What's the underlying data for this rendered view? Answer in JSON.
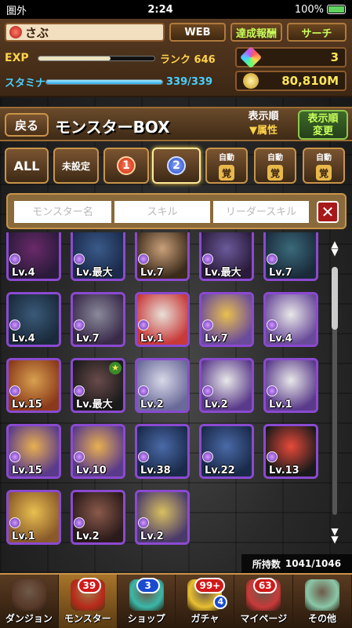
{
  "status_bar": {
    "carrier": "圏外",
    "time": "2:24",
    "battery": "100%"
  },
  "header": {
    "player_name": "さぶ",
    "web_label": "WEB",
    "achievements_label": "達成報酬",
    "search_label": "サーチ",
    "exp_label": "EXP",
    "exp_progress": 0.62,
    "rank_text": "ランク 646",
    "stamina_label": "スタミナ",
    "stamina_progress": 1.0,
    "stamina_text": "339/339",
    "gems": "3",
    "coins": "80,810M"
  },
  "title_bar": {
    "back_label": "戻る",
    "title": "モンスターBOX",
    "sort_label": "表示順",
    "sort_value": "▼属性",
    "sort_change_line1": "表示順",
    "sort_change_line2": "変更"
  },
  "filter_tabs": {
    "all": "ALL",
    "unset": "未設定",
    "box1": "1",
    "box2": "2",
    "auto_label": "自動",
    "auto_icons": [
      "覚",
      "覚",
      "覚"
    ]
  },
  "search": {
    "monster_placeholder": "モンスター名",
    "skill_placeholder": "スキル",
    "leader_placeholder": "リーダースキル"
  },
  "grid": {
    "rows": [
      [
        {
          "lv": "Lv.4",
          "c1": "#6a2a6a",
          "c2": "#2a1a3a",
          "plus": false
        },
        {
          "lv": "Lv.最大",
          "c1": "#3a5a8a",
          "c2": "#1a2a4a",
          "plus": false
        },
        {
          "lv": "Lv.7",
          "c1": "#caa07a",
          "c2": "#3a2a1a",
          "plus": false
        },
        {
          "lv": "Lv.最大",
          "c1": "#6a5a9a",
          "c2": "#2a1a3a",
          "plus": false
        },
        {
          "lv": "Lv.7",
          "c1": "#3a6a7a",
          "c2": "#1a2a3a",
          "plus": false
        }
      ],
      [
        {
          "lv": "Lv.4",
          "c1": "#3a5a7a",
          "c2": "#1a2a3a",
          "plus": false
        },
        {
          "lv": "Lv.7",
          "c1": "#8a8a9a",
          "c2": "#3a2a4a",
          "plus": false
        },
        {
          "lv": "Lv.1",
          "c1": "#e8e0d8",
          "c2": "#c83a3a",
          "plus": false
        },
        {
          "lv": "Lv.7",
          "c1": "#e8c050",
          "c2": "#6a4a9a",
          "plus": false
        },
        {
          "lv": "Lv.4",
          "c1": "#e8e8e8",
          "c2": "#6a4a9a",
          "plus": false
        }
      ],
      [
        {
          "lv": "Lv.15",
          "c1": "#d8a050",
          "c2": "#8a3a1a",
          "plus": false
        },
        {
          "lv": "Lv.最大",
          "c1": "#6a4a4a",
          "c2": "#1a1a1a",
          "plus": true
        },
        {
          "lv": "Lv.2",
          "c1": "#d8d8e8",
          "c2": "#6a6a9a",
          "plus": false
        },
        {
          "lv": "Lv.2",
          "c1": "#e8e8e8",
          "c2": "#5a3a8a",
          "plus": false
        },
        {
          "lv": "Lv.1",
          "c1": "#e8e8e8",
          "c2": "#5a3a8a",
          "plus": false
        }
      ],
      [
        {
          "lv": "Lv.15",
          "c1": "#e8b050",
          "c2": "#5a3a8a",
          "plus": false
        },
        {
          "lv": "Lv.10",
          "c1": "#e8b050",
          "c2": "#5a3a8a",
          "plus": false
        },
        {
          "lv": "Lv.38",
          "c1": "#4a6aa8",
          "c2": "#1a2a4a",
          "plus": false
        },
        {
          "lv": "Lv.22",
          "c1": "#4a6aa8",
          "c2": "#1a2a4a",
          "plus": false
        },
        {
          "lv": "Lv.13",
          "c1": "#e84a3a",
          "c2": "#1a1a1a",
          "plus": false
        }
      ],
      [
        {
          "lv": "Lv.1",
          "c1": "#e8c050",
          "c2": "#8a5a2a",
          "plus": false
        },
        {
          "lv": "Lv.2",
          "c1": "#8a5a4a",
          "c2": "#2a1a1a",
          "plus": false
        },
        {
          "lv": "Lv.2",
          "c1": "#d8c060",
          "c2": "#4a3a6a",
          "plus": false
        }
      ]
    ]
  },
  "box_count": {
    "label": "所持数",
    "value": "1041/1046"
  },
  "bottom_nav": [
    {
      "label": "ダンジョン",
      "badge": "",
      "color": "#5a3a2a"
    },
    {
      "label": "モンスター",
      "badge": "39",
      "badge_color": "red",
      "color": "#b82a1a"
    },
    {
      "label": "ショップ",
      "badge": "3",
      "badge_color": "blue",
      "color": "#3ab8a8"
    },
    {
      "label": "ガチャ",
      "badge": "99+",
      "badge_color": "red",
      "badge2": "4",
      "color": "#e8c030"
    },
    {
      "label": "マイページ",
      "badge": "63",
      "badge_color": "red",
      "color": "#c83a3a"
    },
    {
      "label": "その他",
      "badge": "",
      "color": "#8ac8a8"
    }
  ]
}
